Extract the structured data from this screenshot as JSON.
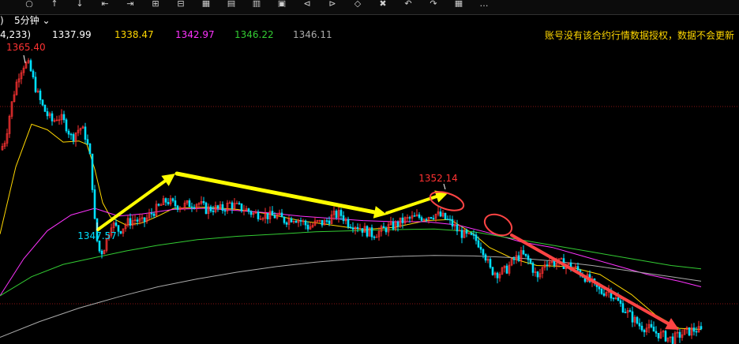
{
  "toolbar": {
    "icons": [
      "record-icon",
      "up-icon",
      "down-icon",
      "prev-icon",
      "next-icon",
      "zoom-in-icon",
      "zoom-out-icon",
      "grid-icon",
      "weekly-icon",
      "monthly-icon",
      "tile-icon",
      "fold-left-icon",
      "fold-right-icon",
      "diamond-icon",
      "cross-icon",
      "back-icon",
      "forward-icon",
      "table-icon",
      "more-icon"
    ],
    "more": "..."
  },
  "period": {
    "paren": ")",
    "label": "5分钟"
  },
  "ma_labels": {
    "params": "4,233)",
    "v1": "1337.99",
    "v2": "1338.47",
    "v3": "1342.97",
    "v4": "1346.22",
    "v5": "1346.11"
  },
  "notice": "账号没有该合约行情数据授权，数据不会更新",
  "colors": {
    "params": "#ffffff",
    "v1": "#ffffff",
    "v2": "#ffd700",
    "v3": "#ff33ff",
    "v4": "#33cc33",
    "v5": "#aaaaaa",
    "up": "#ff3232",
    "down": "#00e0ff",
    "arrow_yellow": "#ffff00",
    "arrow_red": "#ff4444"
  },
  "chart_data": {
    "type": "candlestick",
    "ylim": [
      1340.2,
      1367.0
    ],
    "grid": "horizontal dashed red lines",
    "annotations": [
      {
        "label": "1365.40",
        "color": "#ff3232"
      },
      {
        "label": "1347.57",
        "color": "#00e0ff"
      },
      {
        "label": "1352.14",
        "color": "#ff3232"
      }
    ],
    "price_curve": [
      [
        0,
        1357.5
      ],
      [
        6,
        1358.5
      ],
      [
        12,
        1361
      ],
      [
        18,
        1363
      ],
      [
        24,
        1364.5
      ],
      [
        30,
        1365.2
      ],
      [
        36,
        1365.0
      ],
      [
        42,
        1363.5
      ],
      [
        48,
        1362.2
      ],
      [
        54,
        1361.2
      ],
      [
        60,
        1360.5
      ],
      [
        66,
        1360
      ],
      [
        72,
        1360.5
      ],
      [
        78,
        1360.2
      ],
      [
        84,
        1359.5
      ],
      [
        90,
        1358.5
      ],
      [
        96,
        1359.2
      ],
      [
        102,
        1359.5
      ],
      [
        108,
        1358.6
      ],
      [
        114,
        1356.5
      ],
      [
        120,
        1350
      ],
      [
        126,
        1348.2
      ],
      [
        132,
        1349
      ],
      [
        140,
        1351
      ],
      [
        150,
        1350.3
      ],
      [
        160,
        1351
      ],
      [
        170,
        1351.3
      ],
      [
        180,
        1351
      ],
      [
        190,
        1351.8
      ],
      [
        200,
        1352.4
      ],
      [
        210,
        1353
      ],
      [
        220,
        1352.6
      ],
      [
        230,
        1352.5
      ],
      [
        240,
        1352.7
      ],
      [
        250,
        1352.8
      ],
      [
        260,
        1352.2
      ],
      [
        270,
        1352.3
      ],
      [
        280,
        1352.2
      ],
      [
        290,
        1352.7
      ],
      [
        300,
        1352.4
      ],
      [
        310,
        1352.2
      ],
      [
        320,
        1351.8
      ],
      [
        330,
        1351.8
      ],
      [
        340,
        1351.6
      ],
      [
        350,
        1351.6
      ],
      [
        360,
        1351.2
      ],
      [
        370,
        1351.5
      ],
      [
        380,
        1351.2
      ],
      [
        390,
        1350.6
      ],
      [
        400,
        1351
      ],
      [
        410,
        1351
      ],
      [
        420,
        1351.6
      ],
      [
        430,
        1351.8
      ],
      [
        440,
        1351
      ],
      [
        450,
        1350.8
      ],
      [
        460,
        1350.4
      ],
      [
        470,
        1350
      ],
      [
        480,
        1350.2
      ],
      [
        490,
        1350.6
      ],
      [
        500,
        1350.8
      ],
      [
        510,
        1351.2
      ],
      [
        520,
        1351.4
      ],
      [
        530,
        1351.5
      ],
      [
        540,
        1351.6
      ],
      [
        550,
        1351.8
      ],
      [
        560,
        1351.5
      ],
      [
        570,
        1351
      ],
      [
        580,
        1350.2
      ],
      [
        590,
        1349.8
      ],
      [
        600,
        1349.6
      ],
      [
        610,
        1348.8
      ],
      [
        620,
        1346.8
      ],
      [
        630,
        1346.5
      ],
      [
        640,
        1346.8
      ],
      [
        650,
        1347.7
      ],
      [
        660,
        1348.2
      ],
      [
        670,
        1347.5
      ],
      [
        680,
        1346
      ],
      [
        690,
        1347.6
      ],
      [
        700,
        1347.5
      ],
      [
        710,
        1347.4
      ],
      [
        720,
        1347.2
      ],
      [
        730,
        1346.8
      ],
      [
        740,
        1346.2
      ],
      [
        750,
        1345.5
      ],
      [
        760,
        1344.8
      ],
      [
        770,
        1345
      ],
      [
        780,
        1344.1
      ],
      [
        790,
        1343.3
      ],
      [
        800,
        1342.5
      ],
      [
        810,
        1341.8
      ],
      [
        820,
        1341.6
      ],
      [
        830,
        1341.2
      ],
      [
        840,
        1340.9
      ],
      [
        850,
        1340.6
      ],
      [
        860,
        1341
      ],
      [
        870,
        1341.3
      ],
      [
        880,
        1341.5
      ],
      [
        888,
        1341.3
      ]
    ],
    "series": [
      {
        "values": [
          [
            0,
            1350
          ],
          [
            20,
            1356
          ],
          [
            40,
            1359.8
          ],
          [
            60,
            1359.3
          ],
          [
            80,
            1358.2
          ],
          [
            100,
            1358.3
          ],
          [
            110,
            1358
          ],
          [
            120,
            1355.8
          ],
          [
            130,
            1352.8
          ],
          [
            140,
            1351.5
          ],
          [
            160,
            1350.8
          ],
          [
            180,
            1351
          ],
          [
            200,
            1351.6
          ],
          [
            220,
            1352.3
          ],
          [
            260,
            1352.4
          ],
          [
            300,
            1352.2
          ],
          [
            340,
            1351.8
          ],
          [
            380,
            1351.2
          ],
          [
            420,
            1350.8
          ],
          [
            460,
            1350.4
          ],
          [
            500,
            1350.6
          ],
          [
            540,
            1351.2
          ],
          [
            570,
            1351.3
          ],
          [
            600,
            1350
          ],
          [
            620,
            1348.8
          ],
          [
            650,
            1347.8
          ],
          [
            680,
            1347.2
          ],
          [
            720,
            1347.1
          ],
          [
            760,
            1346.4
          ],
          [
            800,
            1344.6
          ],
          [
            830,
            1342.8
          ],
          [
            860,
            1341.6
          ],
          [
            888,
            1341.5
          ]
        ]
      },
      {
        "values": [
          [
            0,
            1344.5
          ],
          [
            30,
            1347.8
          ],
          [
            60,
            1350.3
          ],
          [
            90,
            1351.7
          ],
          [
            120,
            1352.3
          ],
          [
            150,
            1351.6
          ],
          [
            180,
            1351.8
          ],
          [
            220,
            1352.2
          ],
          [
            260,
            1352.3
          ],
          [
            300,
            1352.1
          ],
          [
            340,
            1351.9
          ],
          [
            380,
            1351.6
          ],
          [
            420,
            1351.4
          ],
          [
            460,
            1351.2
          ],
          [
            500,
            1351.1
          ],
          [
            540,
            1351.1
          ],
          [
            580,
            1350.8
          ],
          [
            620,
            1350.1
          ],
          [
            660,
            1349.3
          ],
          [
            700,
            1348.8
          ],
          [
            740,
            1348
          ],
          [
            780,
            1347.2
          ],
          [
            820,
            1346.4
          ],
          [
            860,
            1345.8
          ],
          [
            888,
            1345.3
          ]
        ]
      },
      {
        "values": [
          [
            0,
            1344.5
          ],
          [
            40,
            1346.2
          ],
          [
            80,
            1347.3
          ],
          [
            120,
            1347.9
          ],
          [
            160,
            1348.5
          ],
          [
            200,
            1349
          ],
          [
            250,
            1349.5
          ],
          [
            300,
            1349.8
          ],
          [
            350,
            1350
          ],
          [
            400,
            1350.2
          ],
          [
            450,
            1350.3
          ],
          [
            500,
            1350.4
          ],
          [
            550,
            1350.45
          ],
          [
            600,
            1350.2
          ],
          [
            650,
            1349.6
          ],
          [
            700,
            1349
          ],
          [
            750,
            1348.4
          ],
          [
            800,
            1347.8
          ],
          [
            850,
            1347.2
          ],
          [
            888,
            1346.9
          ]
        ]
      },
      {
        "values": [
          [
            0,
            1340.8
          ],
          [
            50,
            1342.2
          ],
          [
            100,
            1343.4
          ],
          [
            150,
            1344.4
          ],
          [
            200,
            1345.3
          ],
          [
            250,
            1346
          ],
          [
            300,
            1346.6
          ],
          [
            350,
            1347.1
          ],
          [
            400,
            1347.5
          ],
          [
            450,
            1347.8
          ],
          [
            500,
            1348
          ],
          [
            550,
            1348.1
          ],
          [
            600,
            1348.05
          ],
          [
            650,
            1347.9
          ],
          [
            700,
            1347.6
          ],
          [
            750,
            1347.2
          ],
          [
            800,
            1346.7
          ],
          [
            850,
            1346.2
          ],
          [
            888,
            1345.8
          ]
        ]
      }
    ]
  }
}
